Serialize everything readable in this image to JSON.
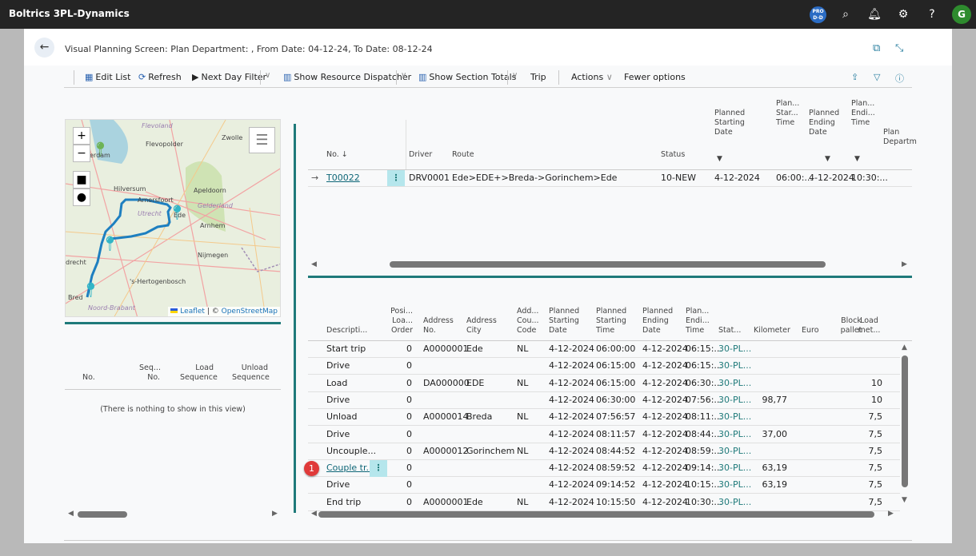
{
  "app": {
    "title": "Boltrics 3PL-Dynamics",
    "env_badge": "PRO D-D",
    "avatar": "G"
  },
  "page": {
    "title": "Visual Planning Screen: Plan Department: , From Date: 04-12-24, To Date: 08-12-24"
  },
  "toolbar": {
    "edit_list": "Edit List",
    "refresh": "Refresh",
    "next_day_filter": "Next Day Filter",
    "show_resource_dispatcher": "Show Resource Dispatcher",
    "show_section_totals": "Show Section Totals",
    "trip": "Trip",
    "actions": "Actions",
    "fewer_options": "Fewer options"
  },
  "map": {
    "zoom_in": "+",
    "zoom_out": "−",
    "leaflet": "Leaflet",
    "osm": "OpenStreetMap",
    "separator": "| ©",
    "labels": [
      "Flevoland",
      "Flevopolder",
      "erdam",
      "Hilversum",
      "Amersfoort",
      "Apeldoorn",
      "Gelderland",
      "Utrecht",
      "Ede",
      "Arnhem",
      "Nijmegen",
      "'s-Hertogenbosch",
      "Bred",
      "Noord-Brabant",
      "Zwolle",
      "drecht"
    ],
    "route_color": "#1e7fc0"
  },
  "left_list": {
    "headers": [
      "No.",
      "Seq... No.",
      "Load Sequence",
      "Unload Sequence"
    ],
    "empty_text": "(There is nothing to show in this view)"
  },
  "trips": {
    "headers": [
      "No. ↓",
      "Driver",
      "Route",
      "Status",
      "Planned Starting Date",
      "Plan... Star... Time",
      "Planned Ending Date",
      "Plan... Endi... Time",
      "Plan Departm"
    ],
    "rows": [
      {
        "no": "T00022",
        "driver": "DRV0001",
        "route": "Ede>EDE+>Breda->Gorinchem>Ede",
        "status": "10-NEW",
        "start_date": "4-12-2024",
        "start_time": "06:00:...",
        "end_date": "4-12-2024",
        "end_time": "10:30:..."
      }
    ]
  },
  "stops": {
    "headers": [
      "Descripti...",
      "Posi... Loa... Order",
      "Address No.",
      "Address City",
      "Add... Cou... Code",
      "Planned Starting Date",
      "Planned Starting Time",
      "Planned Ending Date",
      "Plan... Endi... Time",
      "Stat...",
      "Kilometer",
      "Euro",
      "Block pallet",
      "Load met..."
    ],
    "badge": "1",
    "rows": [
      [
        "Start trip",
        "0",
        "A0000001",
        "Ede",
        "NL",
        "4-12-2024",
        "06:00:00",
        "4-12-2024",
        "06:15:...",
        "30-PL...",
        "",
        "",
        "",
        ""
      ],
      [
        "Drive",
        "0",
        "",
        "",
        "",
        "4-12-2024",
        "06:15:00",
        "4-12-2024",
        "06:15:...",
        "30-PL...",
        "",
        "",
        "",
        ""
      ],
      [
        "Load",
        "0",
        "DA000000",
        "EDE",
        "NL",
        "4-12-2024",
        "06:15:00",
        "4-12-2024",
        "06:30:...",
        "30-PL...",
        "",
        "",
        "",
        "10"
      ],
      [
        "Drive",
        "0",
        "",
        "",
        "",
        "4-12-2024",
        "06:30:00",
        "4-12-2024",
        "07:56:...",
        "30-PL...",
        "98,77",
        "",
        "",
        "10"
      ],
      [
        "Unload",
        "0",
        "A0000014",
        "Breda",
        "NL",
        "4-12-2024",
        "07:56:57",
        "4-12-2024",
        "08:11:...",
        "30-PL...",
        "",
        "",
        "",
        "7,5"
      ],
      [
        "Drive",
        "0",
        "",
        "",
        "",
        "4-12-2024",
        "08:11:57",
        "4-12-2024",
        "08:44:...",
        "30-PL...",
        "37,00",
        "",
        "",
        "7,5"
      ],
      [
        "Uncouple...",
        "0",
        "A0000012",
        "Gorinchem",
        "NL",
        "4-12-2024",
        "08:44:52",
        "4-12-2024",
        "08:59:...",
        "30-PL...",
        "",
        "",
        "",
        "7,5"
      ],
      [
        "Couple tr...",
        "0",
        "",
        "",
        "",
        "4-12-2024",
        "08:59:52",
        "4-12-2024",
        "09:14:...",
        "30-PL...",
        "63,19",
        "",
        "",
        "7,5"
      ],
      [
        "Drive",
        "0",
        "",
        "",
        "",
        "4-12-2024",
        "09:14:52",
        "4-12-2024",
        "10:15:...",
        "30-PL...",
        "63,19",
        "",
        "",
        "7,5"
      ],
      [
        "End trip",
        "0",
        "A0000001",
        "Ede",
        "NL",
        "4-12-2024",
        "10:15:50",
        "4-12-2024",
        "10:30:...",
        "30-PL...",
        "",
        "",
        "",
        "7,5"
      ]
    ]
  }
}
